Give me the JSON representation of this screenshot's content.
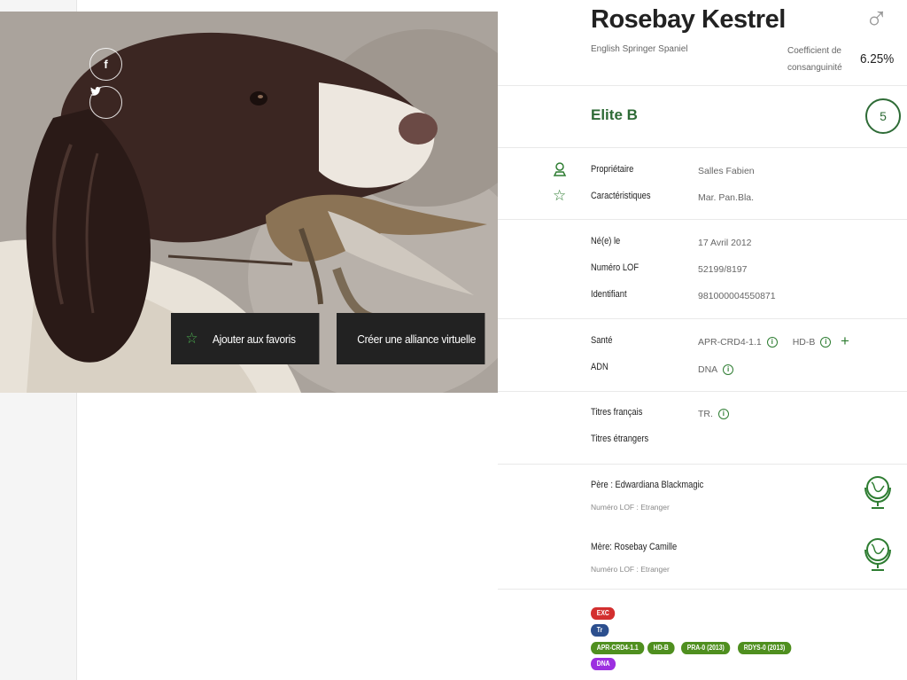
{
  "dog": {
    "name": "Rosebay Kestrel",
    "breed": "English Springer Spaniel",
    "gender_icon": "male-symbol-icon",
    "coefficient_label": "Coefficient de consanguinité",
    "coefficient_value": "6.25%",
    "grade": "Elite B",
    "grade_number": "5"
  },
  "social": {
    "facebook": "f",
    "twitter": "t"
  },
  "actions": {
    "favorite_label": "Ajouter aux favoris",
    "alliance_label": "Créer une alliance virtuelle"
  },
  "owner": {
    "owner_label": "Propriétaire",
    "owner_value": "Salles Fabien",
    "characteristics_label": "Caractéristiques",
    "characteristics_value": "Mar. Pan.Bla."
  },
  "identity": {
    "born_label": "Né(e) le",
    "born_value": "17 Avril 2012",
    "lof_label": "Numéro LOF",
    "lof_value": "52199/8197",
    "id_label": "Identifiant",
    "id_value": "981000004550871"
  },
  "health": {
    "sante_label": "Santé",
    "sante_value_1": "APR-CRD4-1.1",
    "sante_value_2": "HD-B",
    "adn_label": "ADN",
    "adn_value": "DNA"
  },
  "titles": {
    "fr_label": "Titres français",
    "fr_value": "TR.",
    "foreign_label": "Titres étrangers"
  },
  "parents": {
    "father_name": "Père : Edwardiana Blackmagic",
    "father_lof": "Numéro LOF : Etranger",
    "mother_name": "Mère: Rosebay Camille",
    "mother_lof": "Numéro LOF : Etranger"
  },
  "badges": {
    "exc": "EXC",
    "tr": "Tr",
    "apr": "APR-CRD4-1.1",
    "hdb": "HD-B",
    "pra": "PRA-0 (2013)",
    "rdys": "RDYS-0 (2013)",
    "dna": "DNA"
  },
  "colors": {
    "accent_green": "#2e6b36",
    "badge_red": "#d32f2f",
    "badge_blue": "#2c4f8e",
    "badge_green": "#4f8f1f",
    "badge_purple": "#9c2fe0"
  }
}
